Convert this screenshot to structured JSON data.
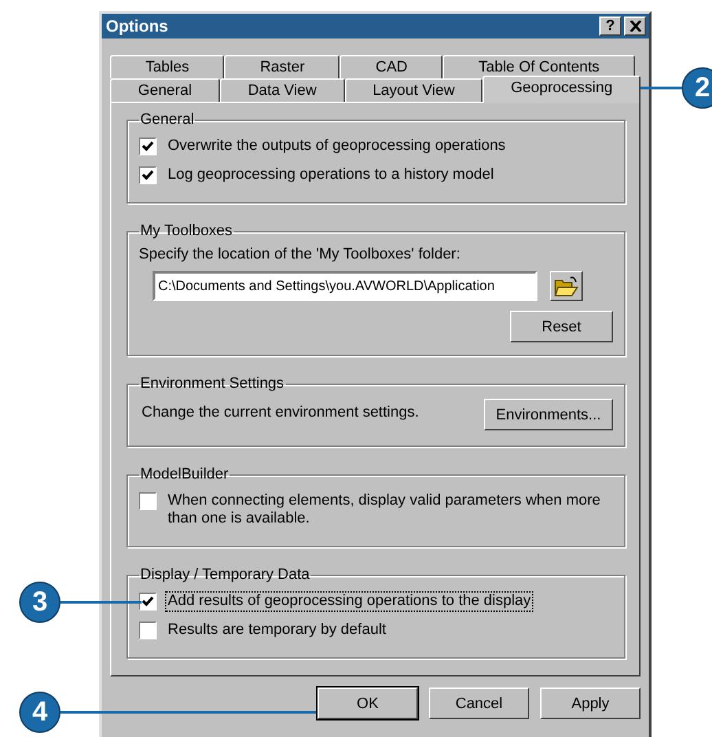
{
  "window": {
    "title": "Options",
    "help_button": "?"
  },
  "tab_rows": [
    [
      {
        "label": "Tables",
        "selected": false
      },
      {
        "label": "Raster",
        "selected": false
      },
      {
        "label": "CAD",
        "selected": false
      },
      {
        "label": "Table Of Contents",
        "selected": false
      }
    ],
    [
      {
        "label": "General",
        "selected": false
      },
      {
        "label": "Data View",
        "selected": false
      },
      {
        "label": "Layout View",
        "selected": false
      },
      {
        "label": "Geoprocessing",
        "selected": true,
        "callout": "2"
      }
    ]
  ],
  "groups": [
    {
      "kind": "checkboxes",
      "title": "General",
      "options": [
        {
          "label": "Overwrite the outputs of geoprocessing operations",
          "checked": true
        },
        {
          "label": "Log geoprocessing operations to a history model",
          "checked": true
        }
      ]
    },
    {
      "kind": "folder",
      "title": "My Toolboxes",
      "prompt": "Specify the location of the 'My Toolboxes' folder:",
      "path": "C:\\Documents and Settings\\you.AVWORLD\\Application",
      "button": "Reset"
    },
    {
      "kind": "action",
      "title": "Environment Settings",
      "text": "Change the current environment settings.",
      "button": "Environments..."
    },
    {
      "kind": "checkboxes",
      "title": "ModelBuilder",
      "options": [
        {
          "label": "When connecting elements, display valid parameters when more than one is available.",
          "checked": false
        }
      ]
    },
    {
      "kind": "checkboxes",
      "title": "Display / Temporary Data",
      "options": [
        {
          "label": "Add results of geoprocessing operations to the display",
          "checked": true,
          "focused": true,
          "callout": "3"
        },
        {
          "label": "Results are temporary by default",
          "checked": false
        }
      ]
    }
  ],
  "buttons": [
    {
      "label": "OK",
      "default": true,
      "callout": "4"
    },
    {
      "label": "Cancel",
      "default": false
    },
    {
      "label": "Apply",
      "default": false
    }
  ]
}
